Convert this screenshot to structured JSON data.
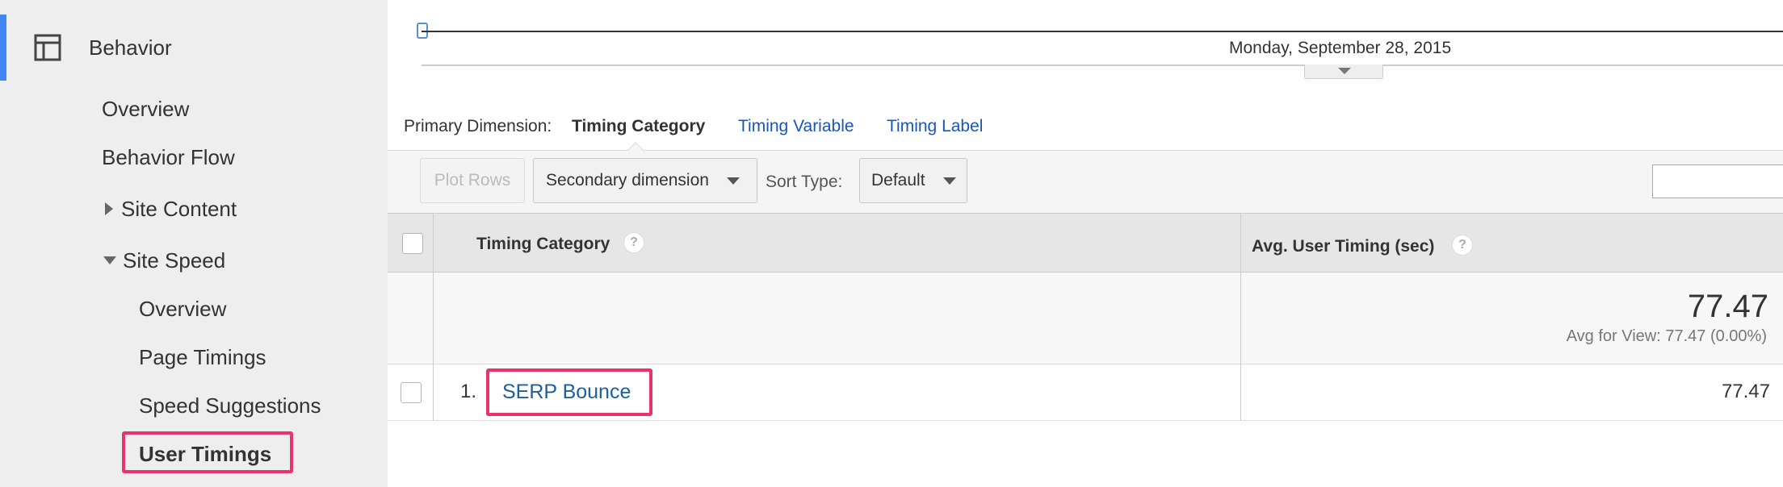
{
  "sidebar": {
    "section_title": "Behavior",
    "section_icon": "behavior-layout-icon",
    "accent_color": "#4285f4",
    "items": [
      {
        "label": "Overview"
      },
      {
        "label": "Behavior Flow"
      },
      {
        "label": "Site Content",
        "expanded": false
      },
      {
        "label": "Site Speed",
        "expanded": true
      }
    ],
    "site_speed_items": [
      {
        "label": "Overview"
      },
      {
        "label": "Page Timings"
      },
      {
        "label": "Speed Suggestions"
      },
      {
        "label": "User Timings",
        "selected": true
      }
    ],
    "highlight_color": "#e8336e"
  },
  "timeline": {
    "date_label": "Monday, September 28, 2015"
  },
  "primary_dimension": {
    "label": "Primary Dimension:",
    "active": "Timing Category",
    "options": [
      "Timing Variable",
      "Timing Label"
    ]
  },
  "toolbar": {
    "plot_rows": "Plot Rows",
    "secondary_dimension": "Secondary dimension",
    "sort_type_label": "Sort Type:",
    "sort_type_value": "Default",
    "search_value": ""
  },
  "table": {
    "columns": [
      "Timing Category",
      "Avg. User Timing (sec)"
    ],
    "help_glyph": "?",
    "summary": {
      "value": "77.47",
      "sub": "Avg for View: 77.47 (0.00%)"
    },
    "rows": [
      {
        "index": "1.",
        "category": "SERP Bounce",
        "avg_timing": "77.47"
      }
    ]
  }
}
